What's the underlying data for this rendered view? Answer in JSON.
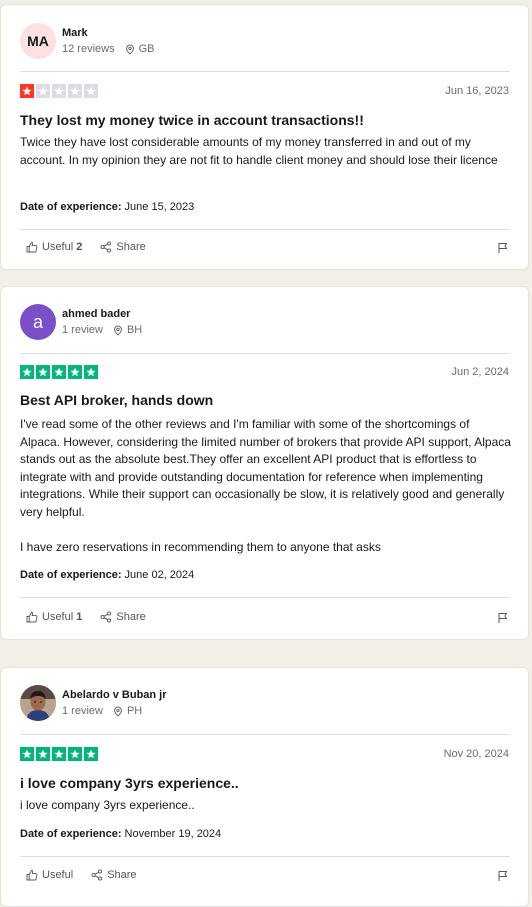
{
  "reviews": [
    {
      "avatar_initials": "MA",
      "avatar_bg": "#fde0e0",
      "name": "Mark",
      "review_count": "12 reviews",
      "country": "GB",
      "rating": 1,
      "star_color": "#ff3722",
      "date": "Jun 16, 2023",
      "title": "They lost my money twice in account transactions!!",
      "body": [
        "Twice they have lost considerable amounts of my money transferred in and out of my account. In my opinion they are not fit to handle client money and should lose their licence"
      ],
      "experience_label": "Date of experience:",
      "experience_date": "June 15, 2023",
      "useful_label": "Useful",
      "useful_count": "2",
      "share_label": "Share"
    },
    {
      "avatar_initials": "a",
      "avatar_bg": "#7b4fc7",
      "name": "ahmed bader",
      "review_count": "1 review",
      "country": "BH",
      "rating": 5,
      "star_color": "#00b67a",
      "date": "Jun 2, 2024",
      "title": "Best API broker, hands down",
      "body": [
        "I've read some of the other reviews and I'm familiar with some of the shortcomings of Alpaca. However, considering the limited number of brokers that provide API support, Alpaca stands out as the absolute best.They offer an excellent API product that is effortless to integrate with and provide outstanding documentation for reference when implementing integrations. While their support can occasionally be slow, it is relatively good and generally very helpful.",
        "I have zero reservations in recommending them to anyone that asks"
      ],
      "experience_label": "Date of experience:",
      "experience_date": "June 02, 2024",
      "useful_label": "Useful",
      "useful_count": "1",
      "share_label": "Share"
    },
    {
      "avatar_initials": "",
      "avatar_bg": "#c9b6a3",
      "name": "Abelardo v Buban jr",
      "review_count": "1 review",
      "country": "PH",
      "rating": 5,
      "star_color": "#00b67a",
      "date": "Nov 20, 2024",
      "title": "i love company 3yrs experience..",
      "body": [
        "i love company 3yrs experience.."
      ],
      "experience_label": "Date of experience:",
      "experience_date": "November 19, 2024",
      "useful_label": "Useful",
      "useful_count": "",
      "share_label": "Share"
    }
  ],
  "empty_star_color": "#dcdce6"
}
